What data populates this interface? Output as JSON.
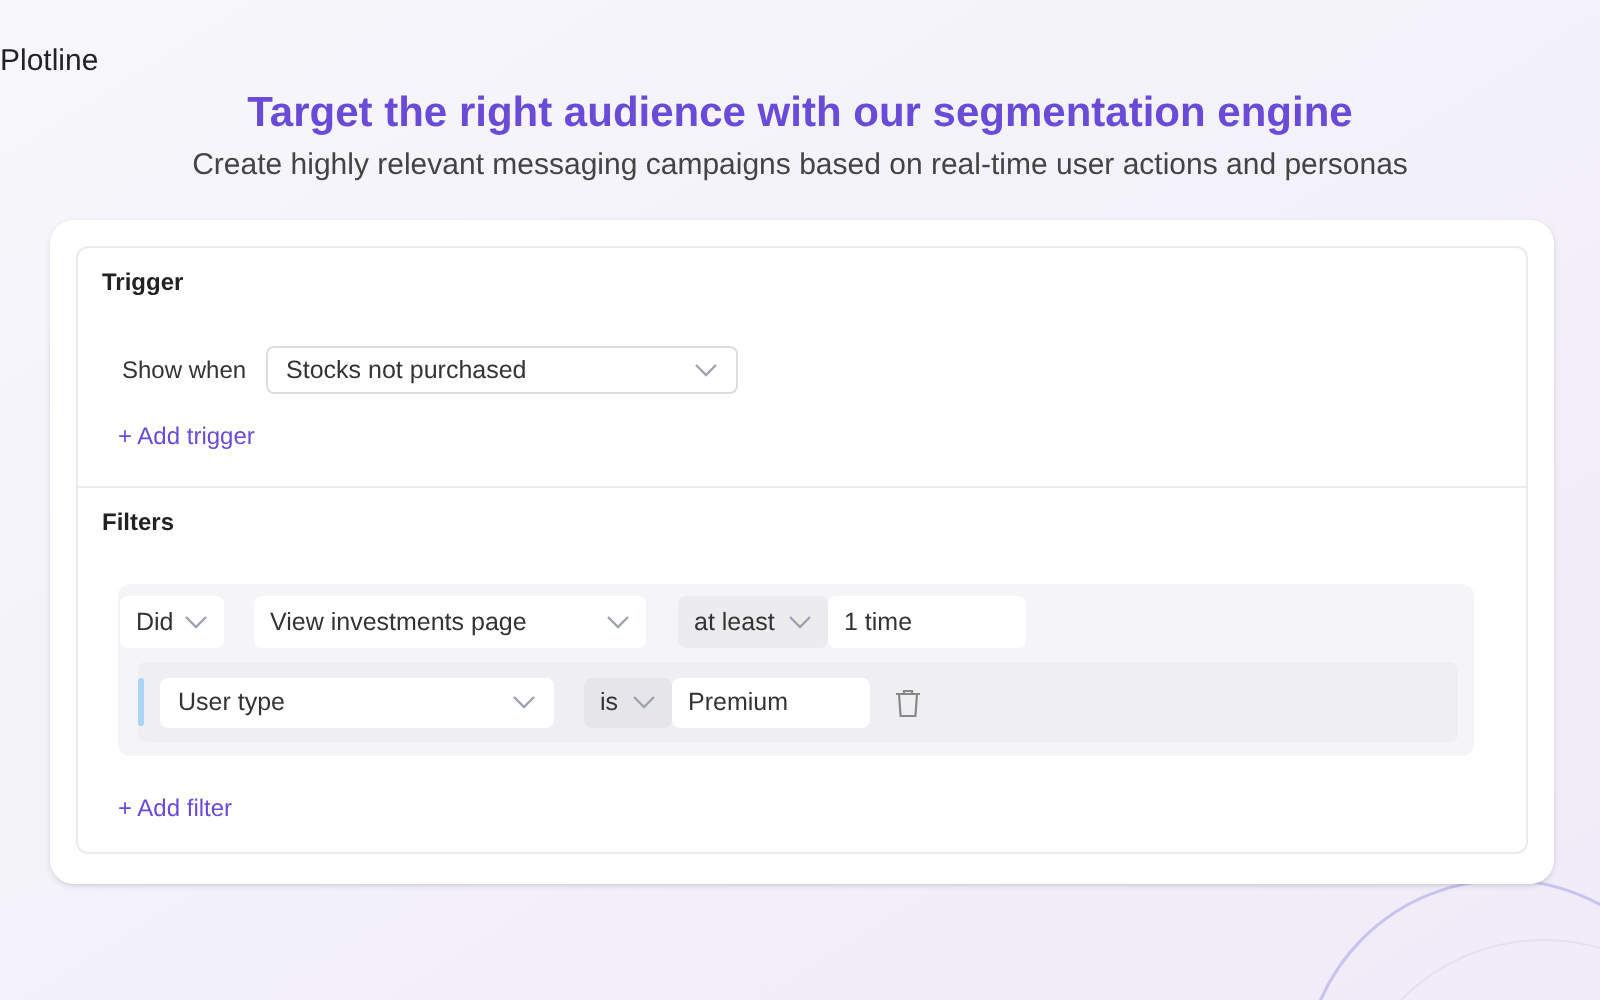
{
  "brand": "Plotline",
  "heading": "Target the right audience with our segmentation engine",
  "subtitle": "Create highly relevant messaging campaigns based on real-time user actions and personas",
  "trigger": {
    "title": "Trigger",
    "label": "Show when",
    "select": "Stocks not purchased",
    "add": "+ Add trigger"
  },
  "filters": {
    "title": "Filters",
    "event": {
      "verb": "Did",
      "event": "View investments page",
      "operator": "at least",
      "count": "1 time"
    },
    "property": {
      "name": "User type",
      "operator": "is",
      "value": "Premium"
    },
    "add": "+ Add filter"
  }
}
